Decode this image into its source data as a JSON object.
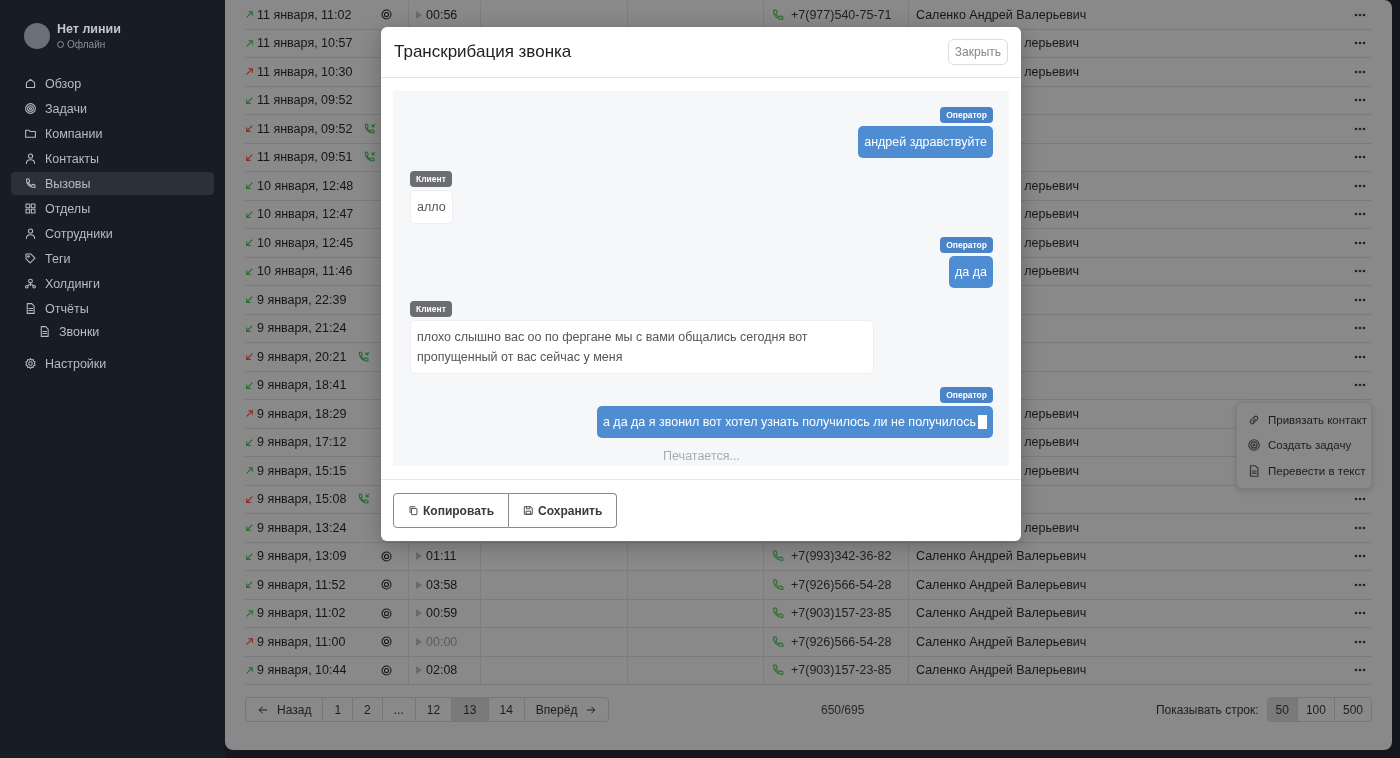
{
  "sidebar": {
    "user": {
      "name": "Нет линии",
      "status": "Офлайн"
    },
    "nav": [
      {
        "label": "Обзор",
        "selected": false
      },
      {
        "label": "Задачи",
        "selected": false
      },
      {
        "label": "Компании",
        "selected": false
      },
      {
        "label": "Контакты",
        "selected": false
      },
      {
        "label": "Вызовы",
        "selected": true
      },
      {
        "label": "Отделы",
        "selected": false
      },
      {
        "label": "Сотрудники",
        "selected": false
      },
      {
        "label": "Теги",
        "selected": false
      },
      {
        "label": "Холдинги",
        "selected": false
      },
      {
        "label": "Отчёты",
        "selected": false,
        "children": [
          {
            "label": "Звонки",
            "selected": false
          }
        ]
      },
      {
        "label": "Настройки",
        "selected": false
      }
    ]
  },
  "calls": {
    "rows": [
      {
        "date": "11 января, 11:02",
        "outgoing": true,
        "answered": true,
        "callback": false,
        "duration": "00:56",
        "phone": "+7(977)540-75-71",
        "contact": "Саленко Андрей Валерьевич",
        "actions": true
      },
      {
        "date": "11 января, 10:57",
        "outgoing": true,
        "answered": true,
        "callback": false,
        "contact": "лерьевич",
        "actions": true
      },
      {
        "date": "11 января, 10:30",
        "outgoing": true,
        "answered": false,
        "callback": false,
        "contact": "лерьевич",
        "actions": true
      },
      {
        "date": "11 января, 09:52",
        "outgoing": false,
        "answered": true,
        "callback": false,
        "actions": true
      },
      {
        "date": "11 января, 09:52",
        "outgoing": false,
        "answered": false,
        "callback": true,
        "actions": true
      },
      {
        "date": "11 января, 09:51",
        "outgoing": false,
        "answered": false,
        "callback": true,
        "actions": true
      },
      {
        "date": "10 января, 12:48",
        "outgoing": false,
        "answered": true,
        "callback": false,
        "contact": "лерьевич",
        "actions": true
      },
      {
        "date": "10 января, 12:47",
        "outgoing": false,
        "answered": true,
        "callback": false,
        "contact": "лерьевич",
        "actions": true
      },
      {
        "date": "10 января, 12:45",
        "outgoing": false,
        "answered": true,
        "callback": false,
        "contact": "лерьевич",
        "actions": true
      },
      {
        "date": "10 января, 11:46",
        "outgoing": false,
        "answered": true,
        "callback": false,
        "contact": "лерьевич",
        "actions": true
      },
      {
        "date": "9 января, 22:39",
        "outgoing": false,
        "answered": true,
        "callback": false,
        "actions": true
      },
      {
        "date": "9 января, 21:24",
        "outgoing": false,
        "answered": true,
        "callback": false,
        "actions": true
      },
      {
        "date": "9 января, 20:21",
        "outgoing": false,
        "answered": false,
        "callback": true,
        "actions": true
      },
      {
        "date": "9 января, 18:41",
        "outgoing": false,
        "answered": true,
        "callback": false,
        "actions": true
      },
      {
        "date": "9 января, 18:29",
        "outgoing": true,
        "answered": false,
        "callback": false,
        "contact": "лерьевич",
        "actions": false
      },
      {
        "date": "9 января, 17:12",
        "outgoing": false,
        "answered": true,
        "callback": false,
        "contact": "лерьевич",
        "actions": false
      },
      {
        "date": "9 января, 15:15",
        "outgoing": true,
        "answered": true,
        "callback": false,
        "contact": "лерьевич",
        "actions": false
      },
      {
        "date": "9 января, 15:08",
        "outgoing": false,
        "answered": false,
        "callback": true,
        "actions": true
      },
      {
        "date": "9 января, 13:24",
        "outgoing": false,
        "answered": true,
        "callback": false,
        "contact": "лерьевич",
        "actions": true
      },
      {
        "date": "9 января, 13:09",
        "outgoing": false,
        "answered": true,
        "callback": false,
        "duration": "01:11",
        "phone": "+7(993)342-36-82",
        "contact": "Саленко Андрей Валерьевич",
        "actions": true
      },
      {
        "date": "9 января, 11:52",
        "outgoing": false,
        "answered": true,
        "callback": false,
        "duration": "03:58",
        "phone": "+7(926)566-54-28",
        "contact": "Саленко Андрей Валерьевич",
        "actions": true
      },
      {
        "date": "9 января, 11:02",
        "outgoing": true,
        "answered": true,
        "callback": false,
        "duration": "00:59",
        "phone": "+7(903)157-23-85",
        "contact": "Саленко Андрей Валерьевич",
        "actions": true
      },
      {
        "date": "9 января, 11:00",
        "outgoing": true,
        "answered": false,
        "callback": false,
        "duration": "00:00",
        "phone": "+7(926)566-54-28",
        "contact": "Саленко Андрей Валерьевич",
        "actions": true
      },
      {
        "date": "9 января, 10:44",
        "outgoing": true,
        "answered": true,
        "callback": false,
        "duration": "02:08",
        "phone": "+7(903)157-23-85",
        "contact": "Саленко Андрей Валерьевич",
        "actions": true
      }
    ]
  },
  "pagination": {
    "prev": "Назад",
    "next": "Вперёд",
    "pages": [
      {
        "label": "1",
        "selected": false
      },
      {
        "label": "2",
        "selected": false
      },
      {
        "label": "...",
        "selected": false
      },
      {
        "label": "12",
        "selected": false
      },
      {
        "label": "13",
        "selected": true
      },
      {
        "label": "14",
        "selected": false
      }
    ],
    "counter": "650/695",
    "rows_label": "Показывать строк:",
    "sizes": [
      {
        "label": "50",
        "selected": true
      },
      {
        "label": "100",
        "selected": false
      },
      {
        "label": "500",
        "selected": false
      }
    ]
  },
  "context_menu": {
    "items": [
      "Привязать контакт",
      "Создать задачу",
      "Перевести в текст"
    ]
  },
  "modal": {
    "title": "Транскрибация звонка",
    "close": "Закрыть",
    "messages": [
      {
        "kind": "operator",
        "speaker": "Оператор",
        "text": "андрей здравствуйте",
        "cursor": false
      },
      {
        "kind": "client",
        "speaker": "Клиент",
        "text": "алло",
        "cursor": false
      },
      {
        "kind": "operator",
        "speaker": "Оператор",
        "text": "да да",
        "cursor": false
      },
      {
        "kind": "client",
        "speaker": "Клиент",
        "text": "плохо слышно вас оо по фергане мы с вами общались сегодня вот пропущенный от вас сейчас у меня",
        "cursor": false
      },
      {
        "kind": "operator",
        "speaker": "Оператор",
        "text": "а да да я звонил вот хотел узнать получилось ли не получилось",
        "cursor": true
      }
    ],
    "status": "Печатается...",
    "buttons": [
      "Копировать",
      "Сохранить"
    ]
  }
}
